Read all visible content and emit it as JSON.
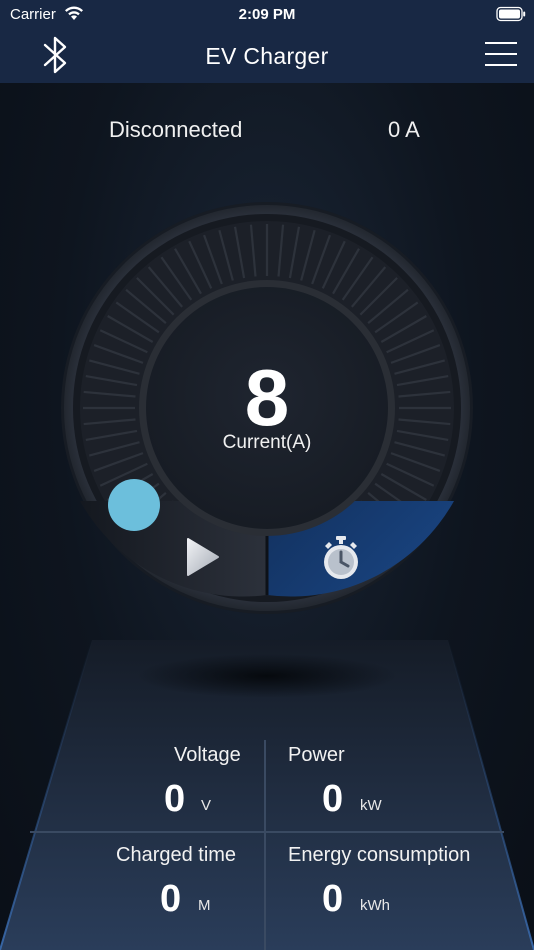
{
  "status_bar": {
    "carrier": "Carrier",
    "time": "2:09 PM"
  },
  "nav": {
    "title": "EV Charger",
    "left_icon": "bluetooth-icon",
    "right_icon": "menu-icon"
  },
  "connection": {
    "status": "Disconnected",
    "current_readout": "0 A"
  },
  "dial": {
    "value": "8",
    "label": "Current(A)",
    "play_icon": "play-icon",
    "timer_icon": "timer-icon"
  },
  "stats": {
    "voltage": {
      "label": "Voltage",
      "value": "0",
      "unit": "V"
    },
    "power": {
      "label": "Power",
      "value": "0",
      "unit": "kW"
    },
    "charged_time": {
      "label": "Charged time",
      "value": "0",
      "unit": "M"
    },
    "energy": {
      "label": "Energy consumption",
      "value": "0",
      "unit": "kWh"
    }
  },
  "colors": {
    "header": "#182844",
    "background": "#0c121b",
    "knob": "#6cbfdc",
    "timer_segment": "#173a6e"
  }
}
